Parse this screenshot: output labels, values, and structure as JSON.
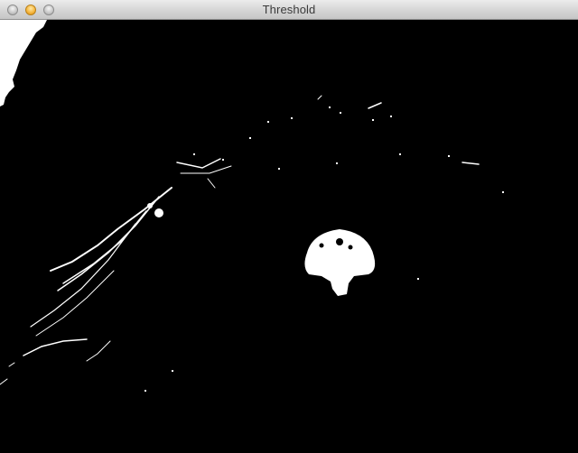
{
  "window": {
    "title": "Threshold",
    "controls": [
      "close",
      "minimize",
      "zoom"
    ]
  },
  "image": {
    "kind": "binary threshold image",
    "foreground_color": "#ffffff",
    "background_color": "#000000"
  }
}
